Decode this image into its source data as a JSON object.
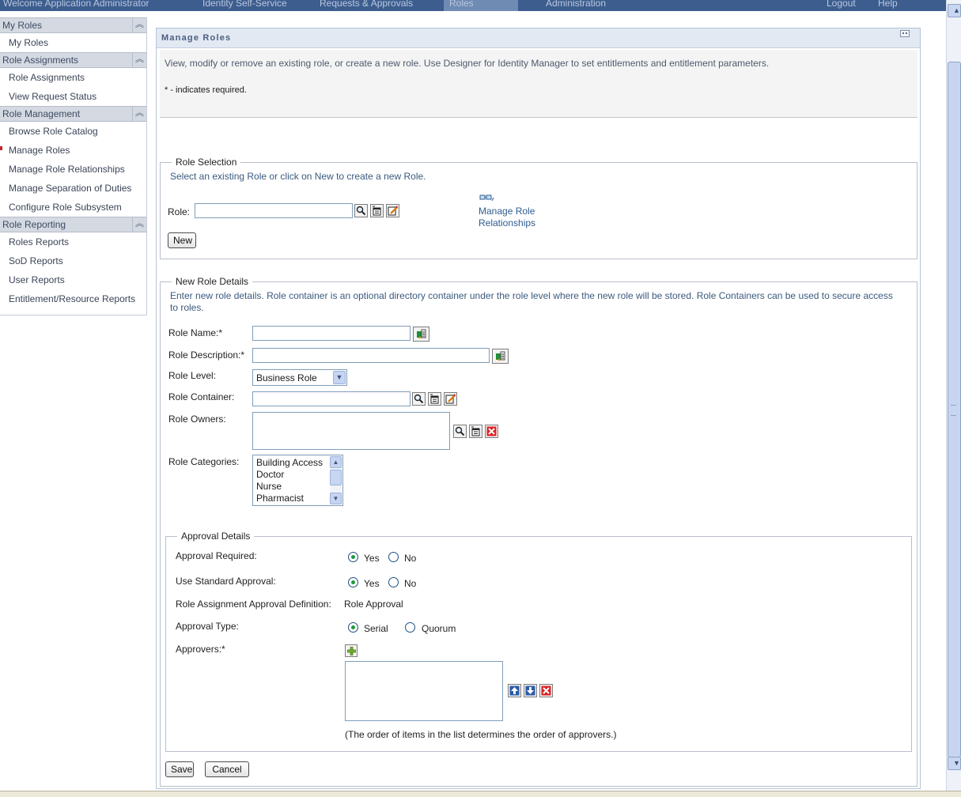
{
  "topbar": {
    "welcome": "Welcome Application Administrator",
    "nav_tabs": [
      "Identity Self-Service",
      "Requests & Approvals",
      "Roles",
      "Administration"
    ],
    "active_tab": "Roles",
    "logout": "Logout",
    "help": "Help"
  },
  "sidebar": {
    "sections": [
      {
        "title": "My Roles",
        "items": [
          "My Roles"
        ]
      },
      {
        "title": "Role Assignments",
        "items": [
          "Role Assignments",
          "View Request Status"
        ]
      },
      {
        "title": "Role Management",
        "items": [
          "Browse Role Catalog",
          "Manage Roles",
          "Manage Role Relationships",
          "Manage Separation of Duties",
          "Configure Role Subsystem"
        ]
      },
      {
        "title": "Role Reporting",
        "items": [
          "Roles Reports",
          "SoD Reports",
          "User Reports",
          "Entitlement/Resource Reports"
        ]
      }
    ],
    "current_item": "Manage Roles"
  },
  "portlet": {
    "title": "Manage Roles",
    "description": "View, modify or remove an existing role, or create a new role. Use Designer for Identity Manager to set entitlements and entitlement parameters.",
    "required_note": "* - indicates required."
  },
  "role_selection": {
    "legend": "Role Selection",
    "hint": "Select an existing Role or click on New to create a new Role.",
    "role_label": "Role:",
    "role_value": "",
    "manage_link_line1": "Manage Role",
    "manage_link_line2": "Relationships",
    "new_button": "New"
  },
  "new_role": {
    "legend": "New Role Details",
    "hint": "Enter new role details. Role container is an optional directory container under the role level where the new role will be stored. Role Containers can be used to secure access to roles.",
    "name_label": "Role Name:*",
    "name_value": "",
    "description_label": "Role Description:*",
    "description_value": "",
    "level_label": "Role Level:",
    "level_value": "Business Role",
    "container_label": "Role Container:",
    "container_value": "",
    "owners_label": "Role Owners:",
    "categories_label": "Role Categories:",
    "categories": [
      "Building Access",
      "Doctor",
      "Nurse",
      "Pharmacist"
    ]
  },
  "approval": {
    "legend": "Approval Details",
    "required_label": "Approval Required:",
    "required_value": "Yes",
    "standard_label": "Use Standard Approval:",
    "standard_value": "Yes",
    "definition_label": "Role Assignment Approval Definition:",
    "definition_value": "Role Approval",
    "type_label": "Approval Type:",
    "type_value": "Serial",
    "option_yes": "Yes",
    "option_no": "No",
    "option_serial": "Serial",
    "option_quorum": "Quorum",
    "approvers_label": "Approvers:*",
    "order_note": "(The order of items in the list determines the order of approvers.)"
  },
  "actions": {
    "save": "Save",
    "cancel": "Cancel"
  }
}
